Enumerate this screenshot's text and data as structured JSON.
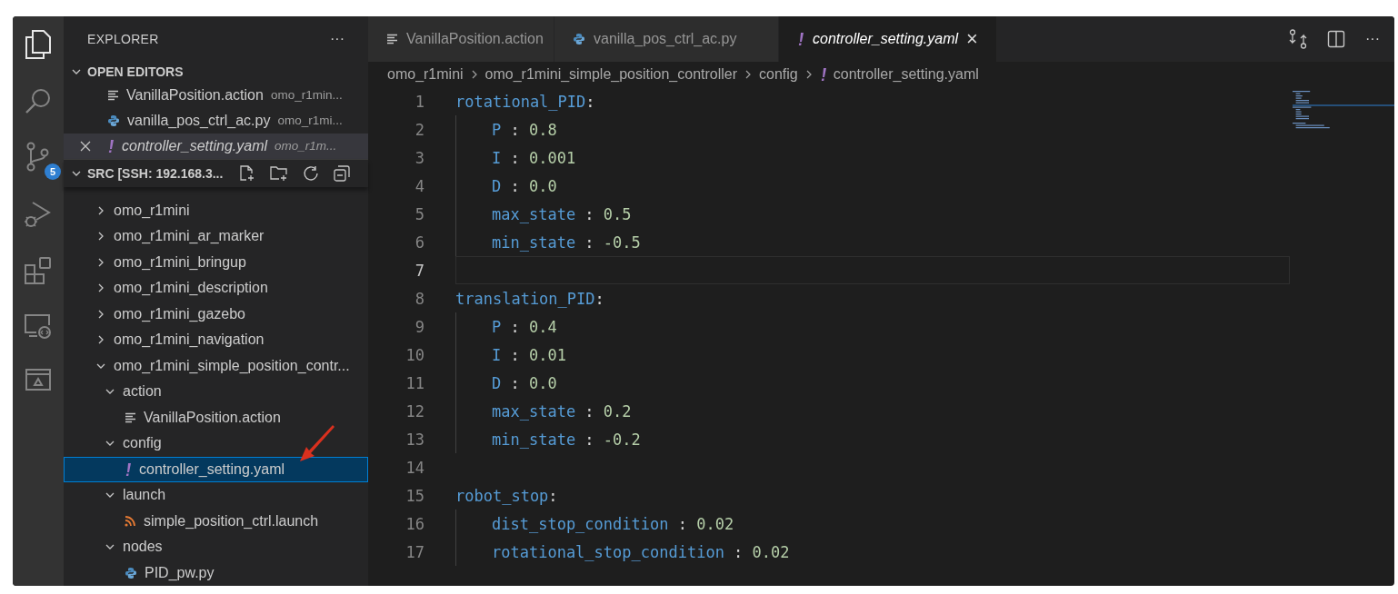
{
  "activity_bar": [
    {
      "kind": "files",
      "selected": true
    },
    {
      "kind": "search",
      "selected": false
    },
    {
      "kind": "source-control",
      "selected": false,
      "badge": "5"
    },
    {
      "kind": "run-debug",
      "selected": false
    },
    {
      "kind": "extensions",
      "selected": false
    },
    {
      "kind": "remote",
      "selected": false
    },
    {
      "kind": "preview",
      "selected": false
    }
  ],
  "sidebar": {
    "title": "EXPLORER",
    "menu": "···",
    "open_editors": {
      "title": "OPEN EDITORS",
      "expanded": true,
      "items": [
        {
          "name": "VanillaPosition.action",
          "path": "omo_r1min...",
          "kind": "action",
          "selected": false,
          "preview": false
        },
        {
          "name": "vanilla_pos_ctrl_ac.py",
          "path": "omo_r1mi...",
          "kind": "python",
          "selected": false,
          "preview": false
        },
        {
          "name": "controller_setting.yaml",
          "path": "omo_r1m...",
          "kind": "yaml",
          "selected": true,
          "preview": true
        }
      ]
    },
    "folder": {
      "title": "SRC [SSH: 192.168.3...",
      "expanded": true,
      "tree": [
        {
          "label": "omo_r1mini",
          "kind": "folder",
          "expanded": false,
          "selected": false
        },
        {
          "label": "omo_r1mini_ar_marker",
          "kind": "folder",
          "expanded": false,
          "selected": false
        },
        {
          "label": "omo_r1mini_bringup",
          "kind": "folder",
          "expanded": false,
          "selected": false
        },
        {
          "label": "omo_r1mini_description",
          "kind": "folder",
          "expanded": false,
          "selected": false
        },
        {
          "label": "omo_r1mini_gazebo",
          "kind": "folder",
          "expanded": false,
          "selected": false
        },
        {
          "label": "omo_r1mini_navigation",
          "kind": "folder",
          "expanded": false,
          "selected": false
        },
        {
          "label": "omo_r1mini_simple_position_contr...",
          "kind": "folder",
          "expanded": true,
          "selected": false,
          "children": [
            {
              "label": "action",
              "kind": "folder",
              "expanded": true,
              "selected": false,
              "children": [
                {
                  "label": "VanillaPosition.action",
                  "kind": "action",
                  "selected": false
                }
              ]
            },
            {
              "label": "config",
              "kind": "folder",
              "expanded": true,
              "selected": false,
              "children": [
                {
                  "label": "controller_setting.yaml",
                  "kind": "yaml",
                  "selected": true
                }
              ]
            },
            {
              "label": "launch",
              "kind": "folder",
              "expanded": true,
              "selected": false,
              "children": [
                {
                  "label": "simple_position_ctrl.launch",
                  "kind": "rss",
                  "selected": false
                }
              ]
            },
            {
              "label": "nodes",
              "kind": "folder",
              "expanded": true,
              "selected": false,
              "children": [
                {
                  "label": "PID_pw.py",
                  "kind": "python",
                  "selected": false
                }
              ]
            }
          ]
        }
      ]
    }
  },
  "tabs": [
    {
      "name": "VanillaPosition.action",
      "kind": "action",
      "selected": false,
      "preview": false
    },
    {
      "name": "vanilla_pos_ctrl_ac.py",
      "kind": "python",
      "selected": false,
      "preview": false
    },
    {
      "name": "controller_setting.yaml",
      "kind": "yaml",
      "selected": true,
      "preview": true,
      "close": "×"
    }
  ],
  "breadcrumbs": [
    {
      "label": "omo_r1mini",
      "kind": "folder"
    },
    {
      "label": "omo_r1mini_simple_position_controller",
      "kind": "folder"
    },
    {
      "label": "config",
      "kind": "folder"
    },
    {
      "label": "controller_setting.yaml",
      "kind": "yaml"
    }
  ],
  "code": [
    {
      "number": "1",
      "key": "rotational_PID",
      "punct": ":",
      "current": false,
      "children": [
        {
          "number": "2",
          "key": "P",
          "punct": " : ",
          "value": "0.8",
          "current": false
        },
        {
          "number": "3",
          "key": "I",
          "punct": " : ",
          "value": "0.001",
          "current": false
        },
        {
          "number": "4",
          "key": "D",
          "punct": " : ",
          "value": "0.0",
          "current": false
        },
        {
          "number": "5",
          "key": "max_state",
          "punct": " : ",
          "value": "0.5",
          "current": false
        },
        {
          "number": "6",
          "key": "min_state",
          "punct": " : ",
          "value": "-0.5",
          "current": false
        }
      ]
    },
    {
      "number": "7",
      "current": true
    },
    {
      "number": "8",
      "key": "translation_PID",
      "punct": ":",
      "current": false,
      "children": [
        {
          "number": "9",
          "key": "P",
          "punct": " : ",
          "value": "0.4",
          "current": false
        },
        {
          "number": "10",
          "key": "I",
          "punct": " : ",
          "value": "0.01",
          "current": false
        },
        {
          "number": "11",
          "key": "D",
          "punct": " : ",
          "value": "0.0",
          "current": false
        },
        {
          "number": "12",
          "key": "max_state",
          "punct": " : ",
          "value": "0.2",
          "current": false
        },
        {
          "number": "13",
          "key": "min_state",
          "punct": " : ",
          "value": "-0.2",
          "current": false
        }
      ]
    },
    {
      "number": "14",
      "current": false
    },
    {
      "number": "15",
      "key": "robot_stop",
      "punct": ":",
      "current": false,
      "children": [
        {
          "number": "16",
          "key": "dist_stop_condition",
          "punct": " : ",
          "value": "0.02",
          "current": false
        },
        {
          "number": "17",
          "key": "rotational_stop_condition",
          "punct": " : ",
          "value": "0.02",
          "current": false
        }
      ]
    }
  ]
}
